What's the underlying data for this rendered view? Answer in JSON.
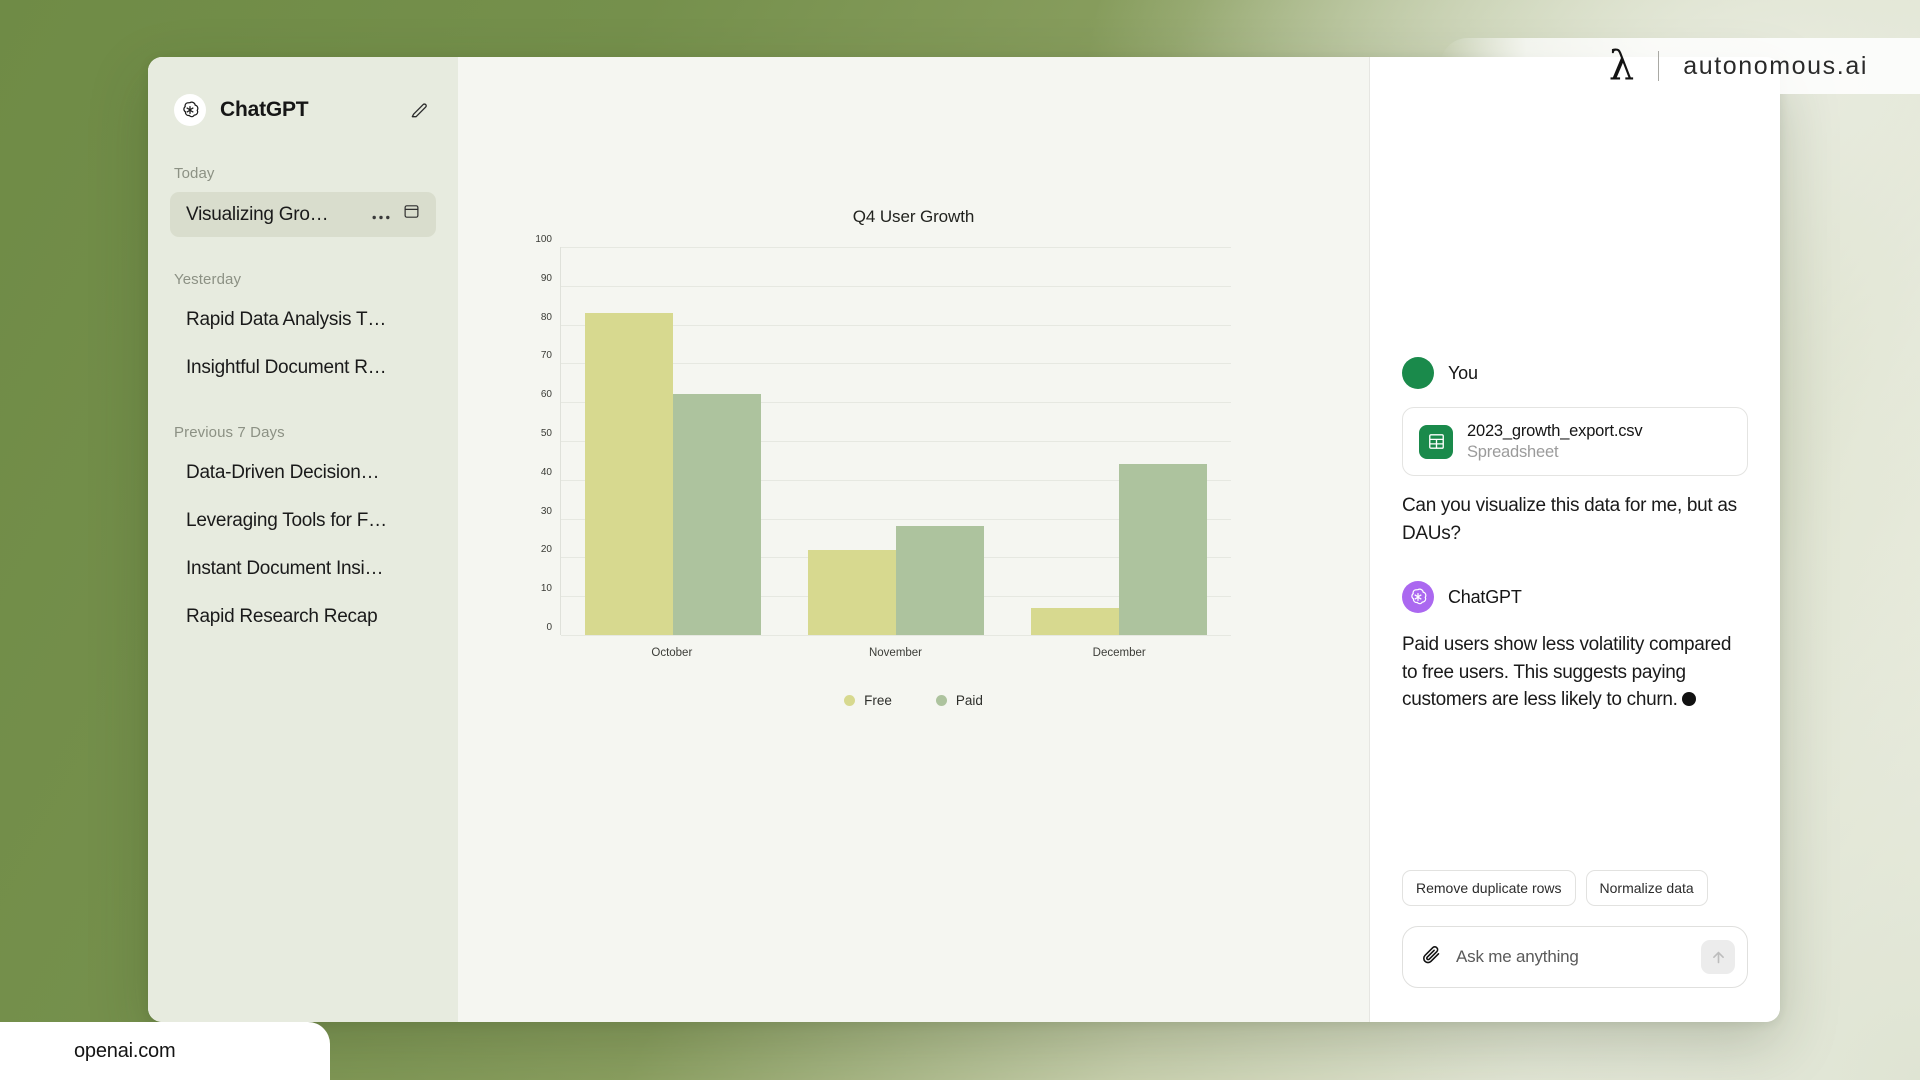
{
  "branding": {
    "lambda_glyph": "λ",
    "logo_text": "autonomous.ai",
    "watermark": "openai.com"
  },
  "sidebar": {
    "app_name": "ChatGPT",
    "compose_icon": "compose-pencil-icon",
    "groups": [
      {
        "label": "Today",
        "items": [
          {
            "label": "Visualizing Gro…",
            "active": true,
            "more_icon": "ellipsis-icon",
            "archive_icon": "archive-icon"
          }
        ]
      },
      {
        "label": "Yesterday",
        "items": [
          {
            "label": "Rapid Data Analysis T…",
            "active": false
          },
          {
            "label": "Insightful Document R…",
            "active": false
          }
        ]
      },
      {
        "label": "Previous 7 Days",
        "items": [
          {
            "label": "Data-Driven Decision…",
            "active": false
          },
          {
            "label": "Leveraging Tools for F…",
            "active": false
          },
          {
            "label": "Instant Document Insi…",
            "active": false
          },
          {
            "label": "Rapid Research Recap",
            "active": false
          }
        ]
      }
    ]
  },
  "chart_data": {
    "type": "bar",
    "title": "Q4 User Growth",
    "xlabel": "",
    "ylabel": "",
    "ylim": [
      0,
      100
    ],
    "yticks": [
      0,
      10,
      20,
      30,
      40,
      50,
      60,
      70,
      80,
      90,
      100
    ],
    "categories": [
      "October",
      "November",
      "December"
    ],
    "grid": true,
    "legend_position": "bottom",
    "series": [
      {
        "name": "Free",
        "color": "#d7d98f",
        "values": [
          83,
          22,
          7
        ]
      },
      {
        "name": "Paid",
        "color": "#adc39e",
        "values": [
          62,
          28,
          44
        ]
      }
    ]
  },
  "chat": {
    "user": {
      "author": "You",
      "attachment": {
        "name": "2023_growth_export.csv",
        "kind": "Spreadsheet",
        "icon": "spreadsheet-icon"
      },
      "text": "Can you visualize this data for me, but as DAUs?"
    },
    "assistant": {
      "author": "ChatGPT",
      "text": "Paid users show less volatility compared to free users. This suggests paying customers are less likely to churn."
    },
    "suggestions": [
      {
        "label": "Remove duplicate rows"
      },
      {
        "label": "Normalize data"
      }
    ],
    "composer": {
      "placeholder": "Ask me anything",
      "attach_icon": "paperclip-icon",
      "send_icon": "arrow-up-icon"
    }
  }
}
